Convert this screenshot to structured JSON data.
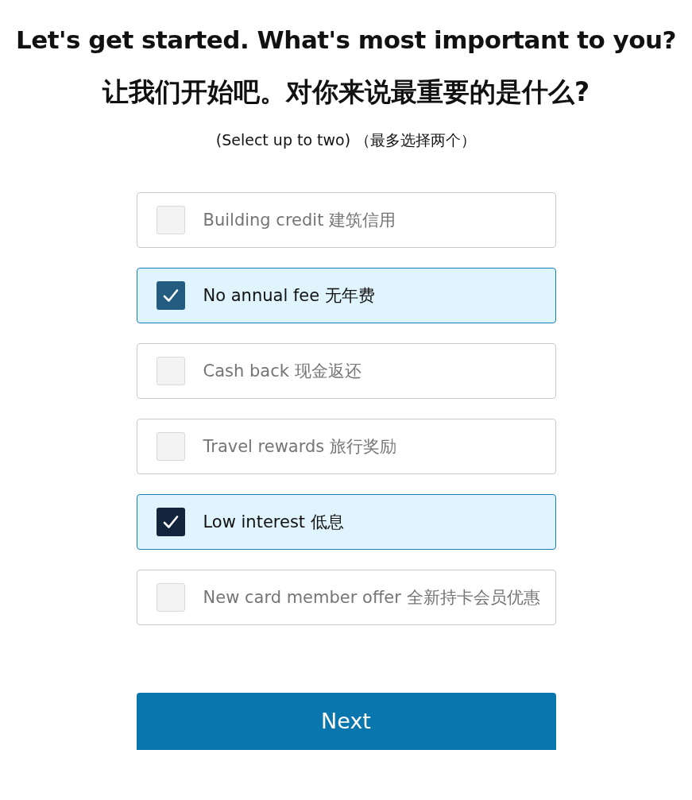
{
  "heading": "Let's get started. What's most important to you?",
  "heading_zh": "让我们开始吧。对你来说最重要的是什么?",
  "hint": "(Select up to two) （最多选择两个）",
  "options": [
    {
      "label": "Building credit 建筑信用",
      "checked": false
    },
    {
      "label": "No annual fee 无年费",
      "checked": true,
      "color": "#245b80"
    },
    {
      "label": "Cash back 现金返还",
      "checked": false
    },
    {
      "label": "Travel rewards 旅行奖励",
      "checked": false
    },
    {
      "label": "Low interest 低息",
      "checked": true,
      "color": "#13243d"
    },
    {
      "label": "New card member offer 全新持卡会员优惠",
      "checked": false
    }
  ],
  "button": "Next"
}
